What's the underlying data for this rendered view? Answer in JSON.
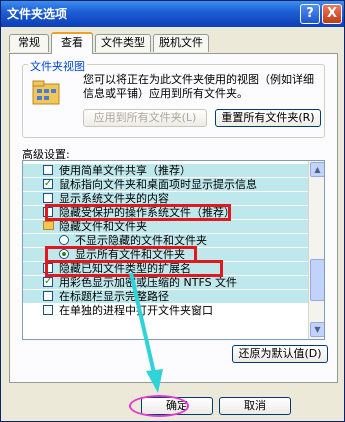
{
  "window": {
    "title": "文件夹选项",
    "help_glyph": "?",
    "close_glyph": "X"
  },
  "tabs": [
    {
      "label": "常规",
      "active": false
    },
    {
      "label": "查看",
      "active": true
    },
    {
      "label": "文件类型",
      "active": false
    },
    {
      "label": "脱机文件",
      "active": false
    }
  ],
  "folder_views": {
    "title": "文件夹视图",
    "description": "您可以将正在为此文件夹使用的视图（例如详细信息或平铺）应用到所有文件夹。",
    "apply_all_label": "应用到所有文件夹(L)",
    "reset_all_label": "重置所有文件夹(R)"
  },
  "advanced": {
    "label": "高级设置:",
    "items": [
      {
        "text": "使用简单文件共享（推荐）",
        "type": "checkbox",
        "checked": false,
        "indent": 1,
        "highlight": true
      },
      {
        "text": "鼠标指向文件夹和桌面项时显示提示信息",
        "type": "checkbox",
        "checked": true,
        "indent": 1,
        "highlight": true
      },
      {
        "text": "显示系统文件夹的内容",
        "type": "checkbox",
        "checked": false,
        "indent": 1,
        "highlight": true
      },
      {
        "text": "隐藏受保护的操作系统文件（推荐）",
        "type": "checkbox",
        "checked": false,
        "indent": 1,
        "highlight": true
      },
      {
        "text": "隐藏文件和文件夹",
        "type": "folder",
        "indent": 1,
        "highlight": true
      },
      {
        "text": "不显示隐藏的文件和文件夹",
        "type": "radio",
        "checked": false,
        "indent": 2,
        "highlight": true
      },
      {
        "text": "显示所有文件和文件夹",
        "type": "radio",
        "checked": true,
        "indent": 2,
        "highlight": true
      },
      {
        "text": "隐藏已知文件类型的扩展名",
        "type": "checkbox",
        "checked": false,
        "indent": 1,
        "highlight": true
      },
      {
        "text": "用彩色显示加密或压缩的 NTFS 文件",
        "type": "checkbox",
        "checked": true,
        "indent": 1,
        "highlight": true
      },
      {
        "text": "在标题栏显示完整路径",
        "type": "checkbox",
        "checked": false,
        "indent": 1,
        "highlight": true
      },
      {
        "text": "在单独的进程中打开文件夹窗口",
        "type": "checkbox",
        "checked": false,
        "indent": 1,
        "highlight": false
      }
    ],
    "restore_defaults_label": "还原为默认值(D)"
  },
  "footer": {
    "ok_label": "确定",
    "cancel_label": "取消"
  },
  "colors": {
    "annotation_red": "#e0191f",
    "annotation_arrow": "#2fd3d8",
    "annotation_ellipse": "#e33bd0",
    "list_highlight": "#bfe8ec"
  }
}
